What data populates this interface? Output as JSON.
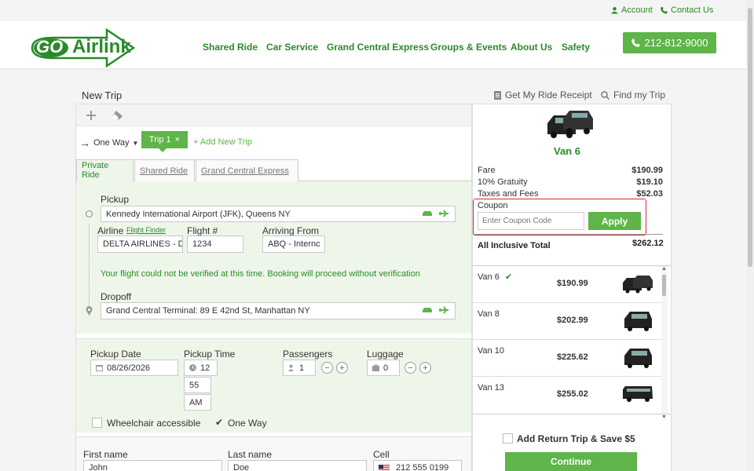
{
  "topbar": {
    "account": "Account",
    "contact": "Contact Us"
  },
  "brand": {
    "logo_text_go": "GO",
    "logo_text_rest": "Airlink"
  },
  "nav": [
    "Shared Ride",
    "Car Service",
    "Grand Central Express",
    "Groups & Events",
    "About Us",
    "Safety"
  ],
  "phone": "212-812-9000",
  "page": {
    "title": "New Trip",
    "receipt_link": "Get My Ride Receipt",
    "find_trip_link": "Find my Trip"
  },
  "trip_bar": {
    "direction": "One Way",
    "trip_tab": "Trip 1",
    "trip_close": "×",
    "add_trip": "+ Add New Trip"
  },
  "service_tabs": [
    "Private Ride",
    "Shared Ride",
    "Grand Central Express"
  ],
  "pickup": {
    "label": "Pickup",
    "value": "Kennedy International Airport (JFK), Queens NY",
    "airline_label": "Airline",
    "flight_finder": "Flight Finder",
    "airline_value": "DELTA AIRLINES - DL",
    "flight_label": "Flight #",
    "flight_value": "1234",
    "arriving_label": "Arriving From",
    "arriving_value": "ABQ - Internc",
    "notice": "Your flight could not be verified at this time. Booking will proceed without verification"
  },
  "dropoff": {
    "label": "Dropoff",
    "value": "Grand Central Terminal: 89 E 42nd St, Manhattan NY"
  },
  "schedule": {
    "date_label": "Pickup Date",
    "date_value": "08/26/2026",
    "time_label": "Pickup Time",
    "hour": "12",
    "minute": "55",
    "ampm": "AM",
    "passengers_label": "Passengers",
    "passengers_value": "1",
    "luggage_label": "Luggage",
    "luggage_value": "0",
    "wheelchair_label": "Wheelchair accessible",
    "oneway_label": "One Way"
  },
  "contact": {
    "first_label": "First name",
    "first_value": "John",
    "last_label": "Last name",
    "last_value": "Doe",
    "cell_label": "Cell",
    "cell_value": "212 555 0199"
  },
  "summary": {
    "vehicle": "Van 6",
    "fare_label": "Fare",
    "fare": "$190.99",
    "gratuity_label": "10% Gratuity",
    "gratuity": "$19.10",
    "taxes_label": "Taxes and Fees",
    "taxes": "$52.03",
    "coupon_label": "Coupon",
    "coupon_placeholder": "Enter Coupon Code",
    "apply": "Apply",
    "total_label": "All Inclusive Total",
    "total": "$262.12"
  },
  "vehicles": [
    {
      "name": "Van 6",
      "price": "$190.99",
      "selected": true,
      "check": "✔"
    },
    {
      "name": "Van 8",
      "price": "$202.99"
    },
    {
      "name": "Van 10",
      "price": "$225.62"
    },
    {
      "name": "Van 13",
      "price": "$255.02"
    }
  ],
  "return_trip": "Add Return Trip & Save $5",
  "continue": "Continue",
  "colors": {
    "brand_green": "#5fb44a",
    "link_green": "#2a8a2a",
    "highlight_red": "#d9262c"
  }
}
